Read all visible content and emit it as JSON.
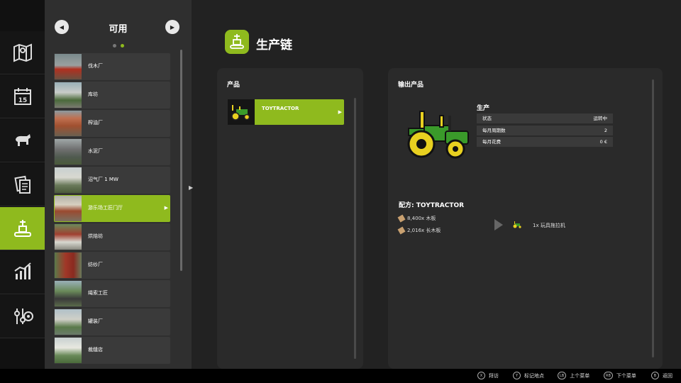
{
  "list": {
    "title": "可用",
    "prev_glyph": "◀",
    "next_glyph": "▶",
    "items": [
      {
        "label": "伐木厂",
        "active": false
      },
      {
        "label": "库坊",
        "active": false
      },
      {
        "label": "榨油厂",
        "active": false
      },
      {
        "label": "水泥厂",
        "active": false
      },
      {
        "label": "沼气厂 1 MW",
        "active": false
      },
      {
        "label": "游乐场工匠门厅",
        "active": true
      },
      {
        "label": "烘焙坊",
        "active": false
      },
      {
        "label": "纺纱厂",
        "active": false
      },
      {
        "label": "绳索工匠",
        "active": false
      },
      {
        "label": "罐装厂",
        "active": false
      },
      {
        "label": "裁缝店",
        "active": false
      }
    ]
  },
  "nav": {
    "items": [
      {
        "icon": "map-icon"
      },
      {
        "icon": "calendar-icon",
        "text": "15"
      },
      {
        "icon": "animals-icon"
      },
      {
        "icon": "contracts-icon"
      },
      {
        "icon": "production-icon"
      },
      {
        "icon": "statistics-icon"
      },
      {
        "icon": "settings-icon"
      }
    ]
  },
  "main": {
    "title": "生产链",
    "products_header": "产品",
    "product": {
      "label": "TOYTRACTOR"
    },
    "output_header": "输出产品",
    "production": {
      "header": "生产",
      "rows": [
        {
          "label": "状态",
          "value": "运转中"
        },
        {
          "label": "每月周期数",
          "value": "2"
        },
        {
          "label": "每月花费",
          "value": "0 €"
        }
      ]
    },
    "recipe": {
      "header": "配方: TOYTRACTOR",
      "inputs": [
        "8,400x 木板",
        "2,016x 长木板"
      ],
      "output": "1x 玩具拖拉机"
    }
  },
  "bottom": {
    "actions": [
      {
        "key": "X",
        "label": "拜访"
      },
      {
        "key": "Y",
        "label": "标记地点"
      },
      {
        "key": "LB",
        "label": "上个菜单"
      },
      {
        "key": "RB",
        "label": "下个菜单"
      },
      {
        "key": "B",
        "label": "返回"
      }
    ]
  },
  "colors": {
    "accent": "#8fba1e",
    "panel": "#2a2a2a",
    "background": "#222222"
  }
}
